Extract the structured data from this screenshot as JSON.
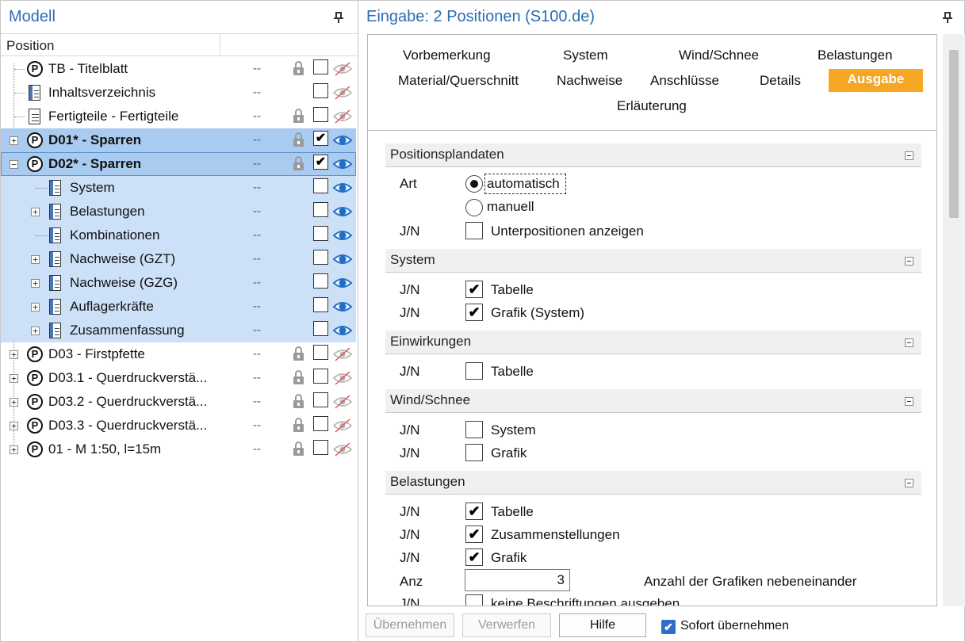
{
  "left_panel": {
    "title": "Modell",
    "column_header": "Position",
    "rows": [
      {
        "label": "TB - Titelblatt",
        "value": "--",
        "checked": "",
        "locked": true
      },
      {
        "label": "Inhaltsverzeichnis",
        "value": "--",
        "checked": "",
        "locked": false
      },
      {
        "label": "Fertigteile - Fertigteile",
        "value": "--",
        "checked": "",
        "locked": true
      },
      {
        "label": "D01* - Sparren",
        "value": "--",
        "checked": "✔",
        "locked": true
      },
      {
        "label": "D02* - Sparren",
        "value": "--",
        "checked": "✔",
        "locked": true
      },
      {
        "label": "System",
        "value": "--",
        "checked": ""
      },
      {
        "label": "Belastungen",
        "value": "--",
        "checked": ""
      },
      {
        "label": "Kombinationen",
        "value": "--",
        "checked": ""
      },
      {
        "label": "Nachweise (GZT)",
        "value": "--",
        "checked": ""
      },
      {
        "label": "Nachweise (GZG)",
        "value": "--",
        "checked": ""
      },
      {
        "label": "Auflagerkräfte",
        "value": "--",
        "checked": ""
      },
      {
        "label": "Zusammenfassung",
        "value": "--",
        "checked": ""
      },
      {
        "label": "D03 - Firstpfette",
        "value": "--",
        "checked": "",
        "locked": true
      },
      {
        "label": "D03.1 - Querdruckverstä...",
        "value": "--",
        "checked": "",
        "locked": true
      },
      {
        "label": "D03.2 - Querdruckverstä...",
        "value": "--",
        "checked": "",
        "locked": true
      },
      {
        "label": "D03.3 - Querdruckverstä...",
        "value": "--",
        "checked": "",
        "locked": true
      },
      {
        "label": "01 - M 1:50, l=15m",
        "value": "--",
        "checked": "",
        "locked": true
      }
    ]
  },
  "right_panel": {
    "title": "Eingabe: 2 Positionen (S100.de)",
    "tabs": [
      "Vorbemerkung",
      "System",
      "Wind/Schnee",
      "Belastungen",
      "Material/Querschnitt",
      "Nachweise",
      "Anschlüsse",
      "Details",
      "Ausgabe",
      "Erläuterung"
    ],
    "active_tab": "Ausgabe",
    "sections": {
      "positionsplandaten": {
        "title": "Positionsplandaten",
        "art_label": "Art",
        "radio_auto": "automatisch",
        "radio_manual": "manuell",
        "jn_label": "J/N",
        "unterpositionen": "Unterpositionen anzeigen"
      },
      "system": {
        "title": "System",
        "jn": "J/N",
        "tabelle": "Tabelle",
        "grafik": "Grafik (System)"
      },
      "einwirkungen": {
        "title": "Einwirkungen",
        "jn": "J/N",
        "tabelle": "Tabelle"
      },
      "wind_schnee": {
        "title": "Wind/Schnee",
        "jn": "J/N",
        "system": "System",
        "grafik": "Grafik"
      },
      "belastungen": {
        "title": "Belastungen",
        "jn": "J/N",
        "tabelle": "Tabelle",
        "zusammenstellungen": "Zusammenstellungen",
        "grafik": "Grafik",
        "anz_label": "Anz",
        "anz_value": "3",
        "anz_desc": "Anzahl der Grafiken nebeneinander",
        "keine": "keine Beschriftungen ausgeben"
      }
    },
    "checkmark": "✔",
    "buttons": {
      "uebernehmen": "Übernehmen",
      "verwerfen": "Verwerfen",
      "hilfe": "Hilfe",
      "sofort": "Sofort übernehmen"
    }
  },
  "colors": {
    "title_blue": "#2b6cb5",
    "selection": "#a9cbf0",
    "active_tab": "#f5a623",
    "eye_blue": "#1f6fc8"
  }
}
